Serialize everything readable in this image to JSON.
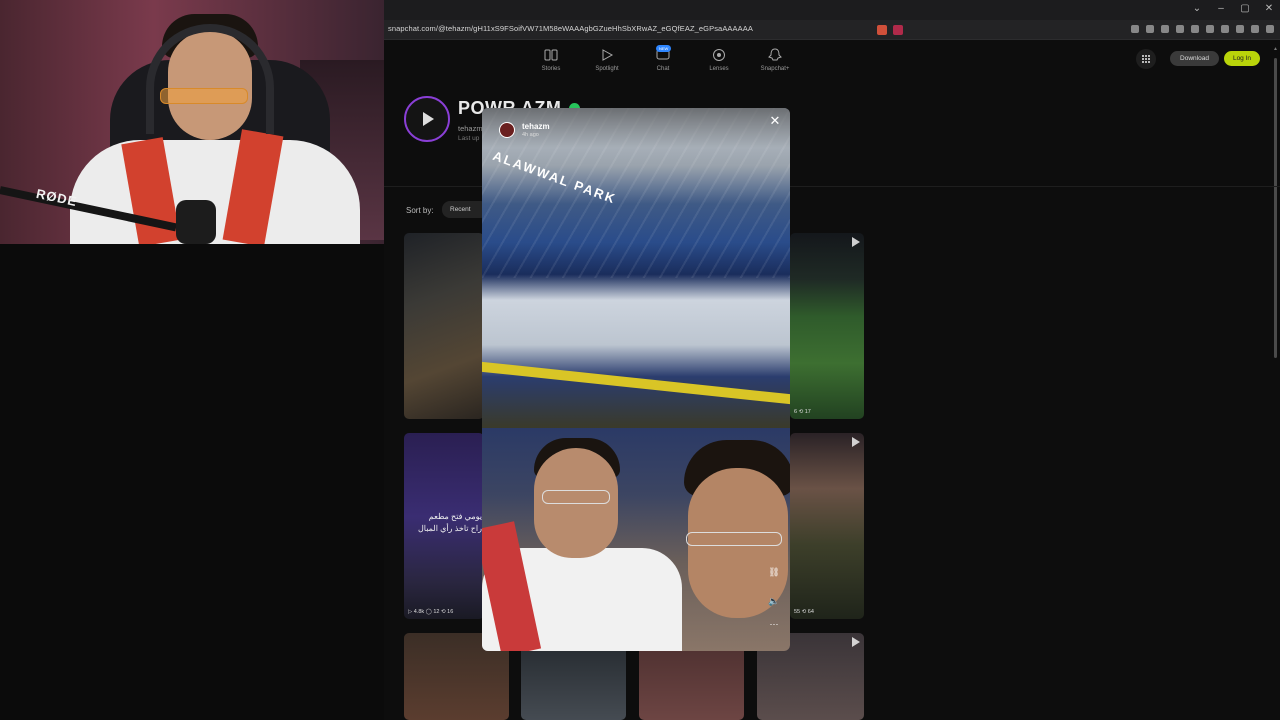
{
  "browser": {
    "url": "snapchat.com/@tehazm/gH11xS9FSoifVW71M58eWAAAgbGZueHhSbXRwAZ_eGQfEAZ_eGPsaAAAAAA",
    "window_controls": [
      "⌄",
      "–",
      "▢",
      "✕"
    ]
  },
  "nav": {
    "items": [
      {
        "label": "Stories",
        "icon": "stories-icon"
      },
      {
        "label": "Spotlight",
        "icon": "spotlight-icon"
      },
      {
        "label": "Chat",
        "icon": "chat-icon"
      },
      {
        "label": "Lenses",
        "icon": "lenses-icon"
      },
      {
        "label": "Snapchat+",
        "icon": "snapchat-plus-icon"
      }
    ],
    "chat_badge": "NEW",
    "download_label": "Download",
    "login_label": "Log In"
  },
  "profile": {
    "name": "POWR AZM",
    "handle": "tehazm",
    "last_updated": "Last up"
  },
  "sort": {
    "label": "Sort by:",
    "value": "Recent"
  },
  "thumbnails": {
    "t1_meta": "",
    "t2_meta": "▷ 4.8k  ◯ 12  ⟲ 16",
    "t2_arabic": "يومي فتح مطعم\nراح تاخذ رأي المبال",
    "t3_meta": "6  ⟲ 17",
    "t4_meta": "55  ⟲ 64"
  },
  "story": {
    "username": "tehazm",
    "time": "4h ago",
    "sign_text": "ALAWWAL PARK",
    "close_symbol": "✕",
    "link_symbol": "⛓",
    "sound_symbol": "🔈",
    "more_symbol": "⋯"
  },
  "webcam": {
    "mic_brand": "RØDE"
  },
  "colors": {
    "accent_login": "#b9d40a",
    "story_ring": "#8a3fd6",
    "verified": "#27c45b"
  }
}
